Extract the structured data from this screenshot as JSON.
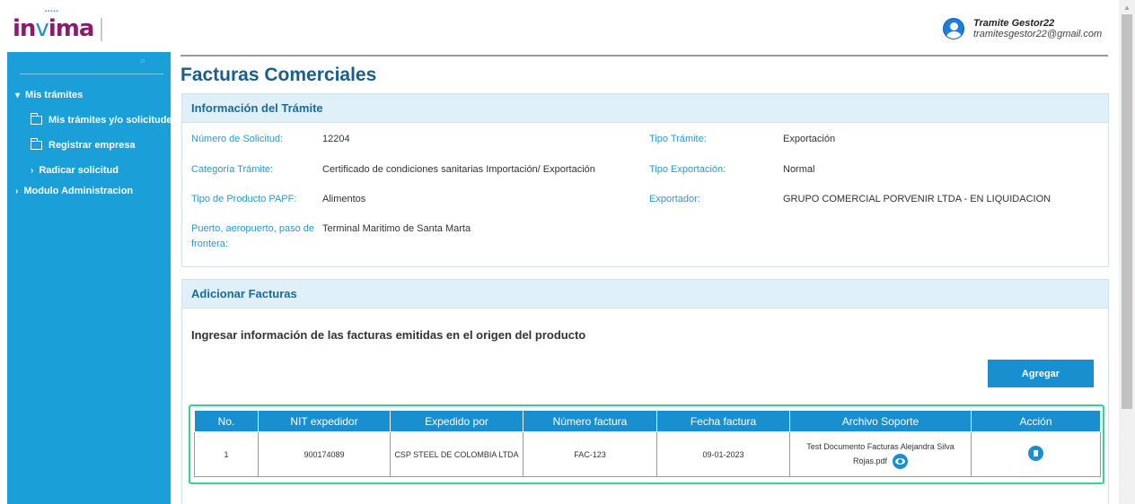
{
  "header": {
    "logo_text_left": "in",
    "logo_text_right": "ima",
    "user_name": "Tramite Gestor22",
    "user_email": "tramitesgestor22@gmail.com"
  },
  "sidebar": {
    "items": [
      {
        "label": "Mis trámites"
      },
      {
        "label": "Mis trámites y/o solicitudes"
      },
      {
        "label": "Registrar empresa"
      },
      {
        "label": "Radicar solicitud"
      },
      {
        "label": "Modulo Administracion"
      }
    ]
  },
  "page": {
    "title": "Facturas Comerciales"
  },
  "info_panel": {
    "title": "Información del Trámite",
    "numero_solicitud_label": "Número de Solicitud:",
    "numero_solicitud_value": "12204",
    "categoria_label": "Categoría Trámite:",
    "categoria_value": "Certificado de condiciones sanitarias Importación/ Exportación",
    "tipo_producto_label": "Tipo de Producto PAPF:",
    "tipo_producto_value": "Alimentos",
    "puerto_label": "Puerto, aeropuerto, paso de frontera:",
    "puerto_value": "Terminal Maritimo de Santa Marta",
    "tipo_tramite_label": "Tipo Trámite:",
    "tipo_tramite_value": "Exportación",
    "tipo_exportacion_label": "Tipo Exportación:",
    "tipo_exportacion_value": "Normal",
    "exportador_label": "Exportador:",
    "exportador_value": "GRUPO COMERCIAL PORVENIR LTDA - EN LIQUIDACION"
  },
  "facturas_panel": {
    "title": "Adicionar Facturas",
    "instruction": "Ingresar información de las facturas emitidas en el origen del producto",
    "add_button": "Agregar",
    "columns": [
      "No.",
      "NIT expedidor",
      "Expedido por",
      "Número factura",
      "Fecha factura",
      "Archivo Soporte",
      "Acción"
    ],
    "rows": [
      {
        "no": "1",
        "nit": "900174089",
        "expedido_por": "CSP STEEL DE COLOMBIA LTDA",
        "numero_factura": "FAC-123",
        "fecha": "09-01-2023",
        "archivo": "Test Documento Facturas Alejandra Silva Rojas.pdf"
      }
    ]
  }
}
